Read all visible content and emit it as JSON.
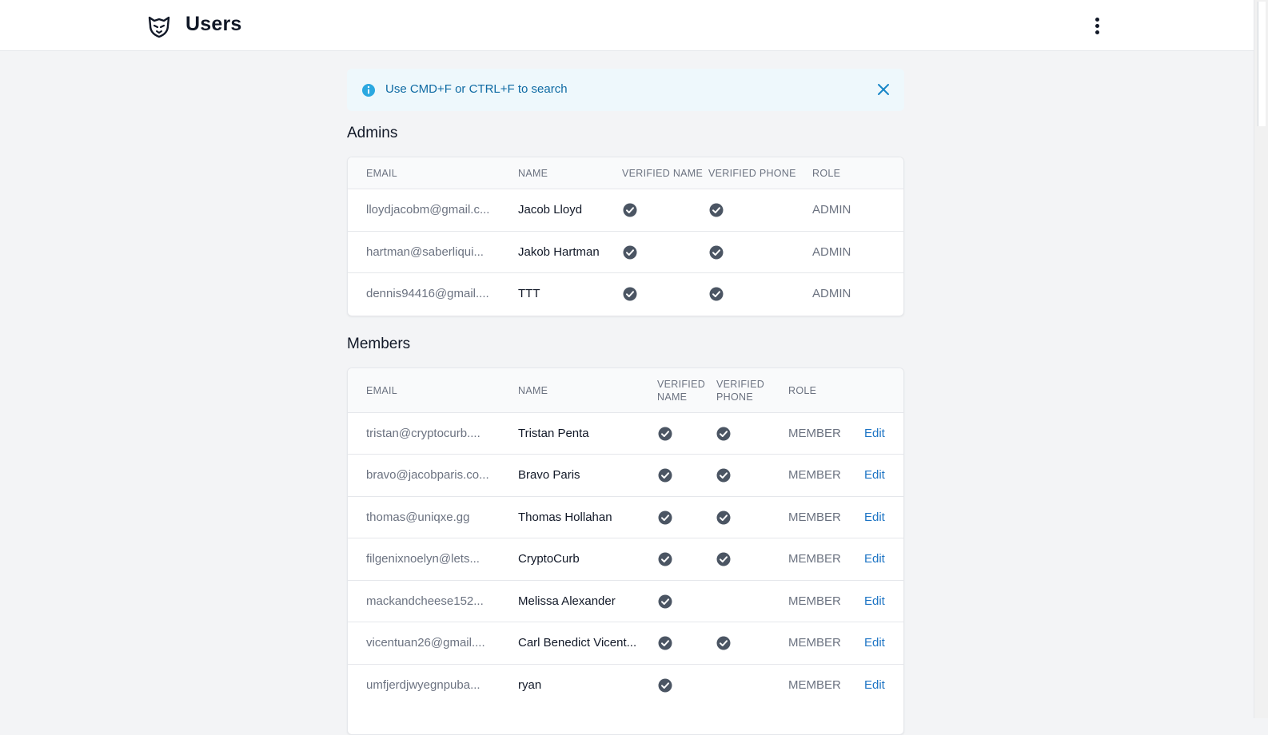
{
  "header": {
    "title": "Users"
  },
  "alert": {
    "text": "Use CMD+F or CTRL+F to search"
  },
  "admins": {
    "title": "Admins",
    "columns": [
      "EMAIL",
      "NAME",
      "VERIFIED NAME",
      "VERIFIED PHONE",
      "ROLE"
    ],
    "rows": [
      {
        "email": "lloydjacobm@gmail.c...",
        "name": "Jacob Lloyd",
        "verified_name": true,
        "verified_phone": true,
        "role": "ADMIN"
      },
      {
        "email": "hartman@saberliqui...",
        "name": "Jakob Hartman",
        "verified_name": true,
        "verified_phone": true,
        "role": "ADMIN"
      },
      {
        "email": "dennis94416@gmail....",
        "name": "TTT",
        "verified_name": true,
        "verified_phone": true,
        "role": "ADMIN"
      }
    ]
  },
  "members": {
    "title": "Members",
    "columns": {
      "email": "EMAIL",
      "name": "NAME",
      "verified_name_1": "VERIFIED",
      "verified_name_2": "NAME",
      "verified_phone_1": "VERIFIED",
      "verified_phone_2": "PHONE",
      "role": "ROLE"
    },
    "edit_label": "Edit",
    "rows": [
      {
        "email": "tristan@cryptocurb....",
        "name": "Tristan Penta",
        "verified_name": true,
        "verified_phone": true,
        "role": "MEMBER"
      },
      {
        "email": "bravo@jacobparis.co...",
        "name": "Bravo Paris",
        "verified_name": true,
        "verified_phone": true,
        "role": "MEMBER"
      },
      {
        "email": "thomas@uniqxe.gg",
        "name": "Thomas Hollahan",
        "verified_name": true,
        "verified_phone": true,
        "role": "MEMBER"
      },
      {
        "email": "filgenixnoelyn@lets...",
        "name": "CryptoCurb",
        "verified_name": true,
        "verified_phone": true,
        "role": "MEMBER"
      },
      {
        "email": "mackandcheese152...",
        "name": "Melissa Alexander",
        "verified_name": true,
        "verified_phone": false,
        "role": "MEMBER"
      },
      {
        "email": "vicentuan26@gmail....",
        "name": "Carl Benedict Vicent...",
        "verified_name": true,
        "verified_phone": true,
        "role": "MEMBER"
      },
      {
        "email": "umfjerdjwyegnpuba...",
        "name": "ryan",
        "verified_name": true,
        "verified_phone": false,
        "role": "MEMBER"
      }
    ]
  },
  "colors": {
    "accent_link": "#1d74c4",
    "alert_bg": "#eef8fc",
    "alert_text": "#0e6aa3",
    "check_fill": "#4b5563"
  },
  "icons": {
    "logo": "tiger-logo-icon",
    "menu": "kebab-menu-icon",
    "info": "info-icon",
    "close": "close-icon",
    "check": "check-circle-icon"
  }
}
